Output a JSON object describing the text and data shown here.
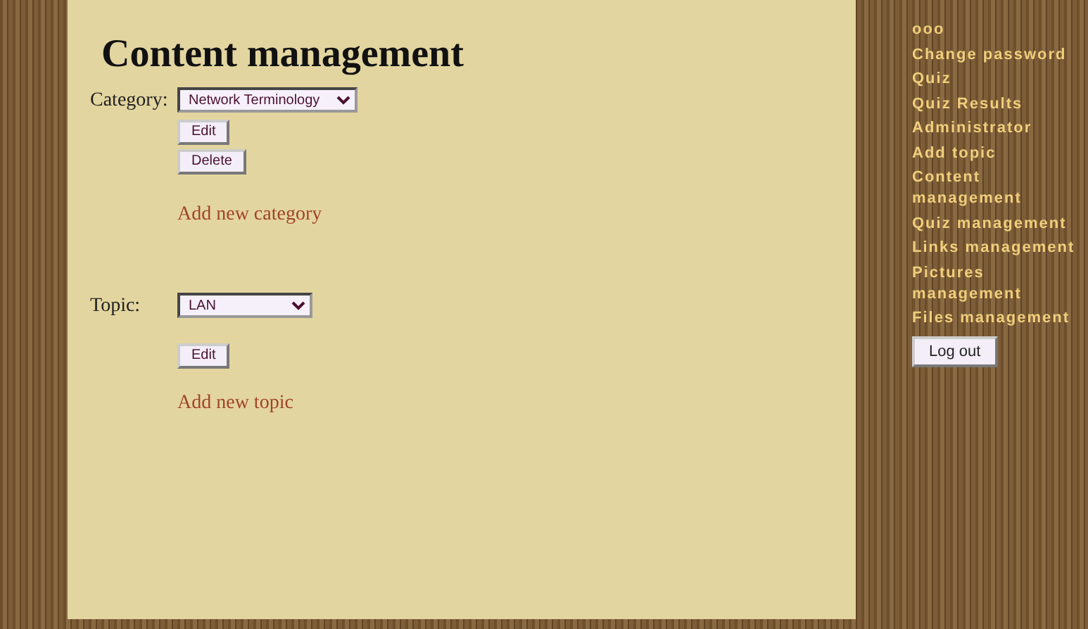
{
  "title": "Content management",
  "category": {
    "label": "Category:",
    "value": "Network Terminology",
    "buttons": [
      "Edit",
      "Delete"
    ],
    "add_link": "Add new category"
  },
  "topic": {
    "label": "Topic:",
    "value": "LAN",
    "buttons": [
      "Edit"
    ],
    "add_link": "Add new topic"
  },
  "sidebar": {
    "items": [
      {
        "label": "ooo"
      },
      {
        "label": "Change password"
      },
      {
        "label": "Quiz"
      },
      {
        "label": "Quiz Results"
      },
      {
        "label": "Administrator"
      },
      {
        "label": "Add topic"
      },
      {
        "label": "Content management"
      },
      {
        "label": "Quiz management"
      },
      {
        "label": "Links management"
      },
      {
        "label": "Pictures management"
      },
      {
        "label": "Files management"
      }
    ],
    "logout": "Log out"
  }
}
